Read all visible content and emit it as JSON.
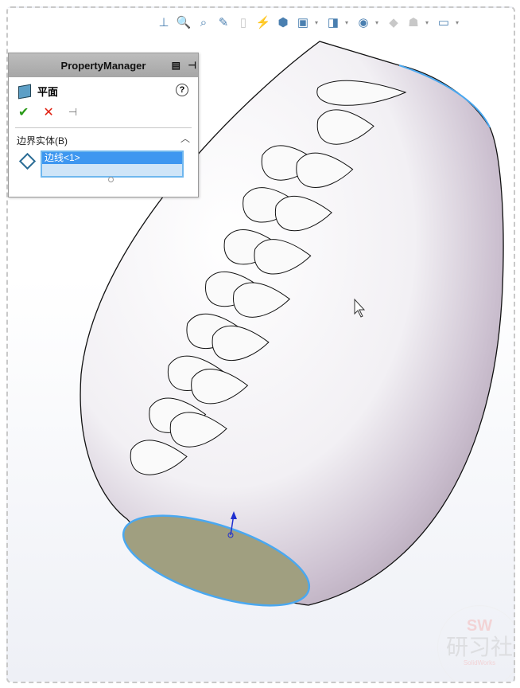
{
  "toolbar": {
    "items": [
      {
        "icon": "normal-to-icon",
        "glyph": "⊥"
      },
      {
        "icon": "zoom-to-fit-icon",
        "glyph": "🔍"
      },
      {
        "icon": "zoom-to-area-icon",
        "glyph": "⌕"
      },
      {
        "icon": "previous-view-icon",
        "glyph": "✎"
      },
      {
        "icon": "section-view-icon",
        "glyph": "▯"
      },
      {
        "icon": "dynamic-annotation-icon",
        "glyph": "⚡"
      },
      {
        "icon": "view-orientation-icon",
        "glyph": "⬢"
      },
      {
        "icon": "display-style-icon",
        "glyph": "▣"
      },
      {
        "icon": "hide-show-items-icon",
        "glyph": "◨"
      },
      {
        "icon": "edit-appearance-icon",
        "glyph": "◉"
      },
      {
        "icon": "apply-scene-icon",
        "glyph": "◆"
      },
      {
        "icon": "view-settings-icon",
        "glyph": "☗"
      },
      {
        "icon": "monitor-icon",
        "glyph": "▭"
      }
    ]
  },
  "property_manager": {
    "title": "PropertyManager",
    "feature_name": "平面",
    "help": "?",
    "ok": "✔",
    "cancel": "✕",
    "pin": "⊣",
    "section_label": "边界实体(B)",
    "selection_item": "边线<1>"
  },
  "watermark": {
    "line1": "SW",
    "line2": "研习社",
    "line3": "SolidWorks"
  },
  "colors": {
    "selection_blue": "#3e97f0",
    "face_fill": "#a09f80",
    "edge_highlight": "#4aa8f0"
  }
}
